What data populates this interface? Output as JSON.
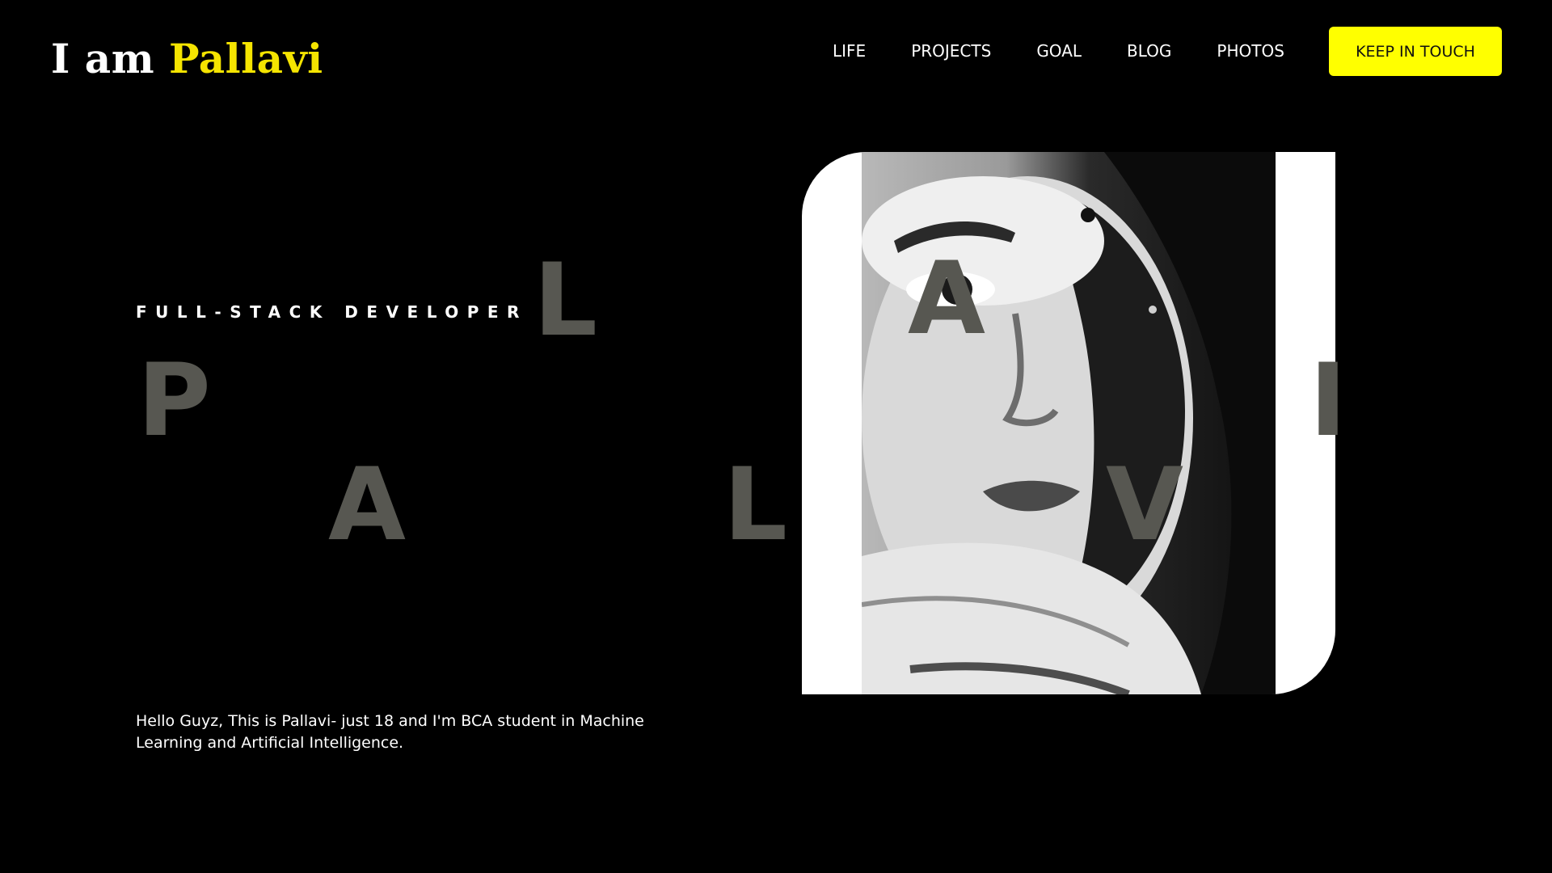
{
  "header": {
    "logo_lead": "I am",
    "logo_name": "Pallavi",
    "nav": [
      "LIFE",
      "PROJECTS",
      "GOAL",
      "BLOG",
      "PHOTOS"
    ],
    "cta_label": "KEEP IN TOUCH"
  },
  "hero": {
    "subtitle": "FULL-STACK DEVELOPER",
    "big_letters": [
      "P",
      "A",
      "L",
      "L",
      "A",
      "V",
      "I"
    ],
    "intro": "Hello Guyz, This is Pallavi- just 18 and I'm BCA student in Machine Learning and Artificial Intelligence."
  },
  "colors": {
    "background": "#000000",
    "accent": "#ffff00",
    "logo_name": "#f5e400",
    "big_letter": "#575751",
    "card": "#ffffff"
  },
  "icons": {
    "photo": "portrait-photo"
  }
}
